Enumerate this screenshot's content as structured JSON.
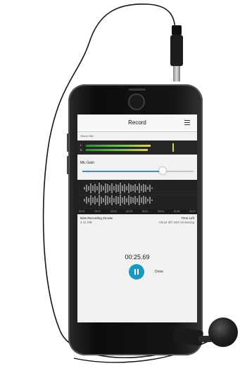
{
  "app": {
    "title": "Record",
    "input_label": "Stereo Mic",
    "gain_label": "Mic Gain",
    "gain_level": 0.72,
    "timeline_ticks": [
      "00:01",
      "00:17",
      "00:22",
      "00:23",
      "00:21",
      "00:24",
      "00:26",
      "00:27"
    ],
    "file_name": "New Recording 19.wav",
    "file_size": "4.41 MB",
    "time_left_label": "Time Left",
    "time_left_value": "About 6th 34m remaining",
    "elapsed": "00:25.69",
    "done_label": "Done"
  },
  "colors": {
    "accent": "#1a98c0",
    "meter_green": "#7cc74a",
    "meter_yellow": "#d7d244"
  },
  "icons": [
    "menu-icon",
    "pause-icon",
    "home-button"
  ]
}
